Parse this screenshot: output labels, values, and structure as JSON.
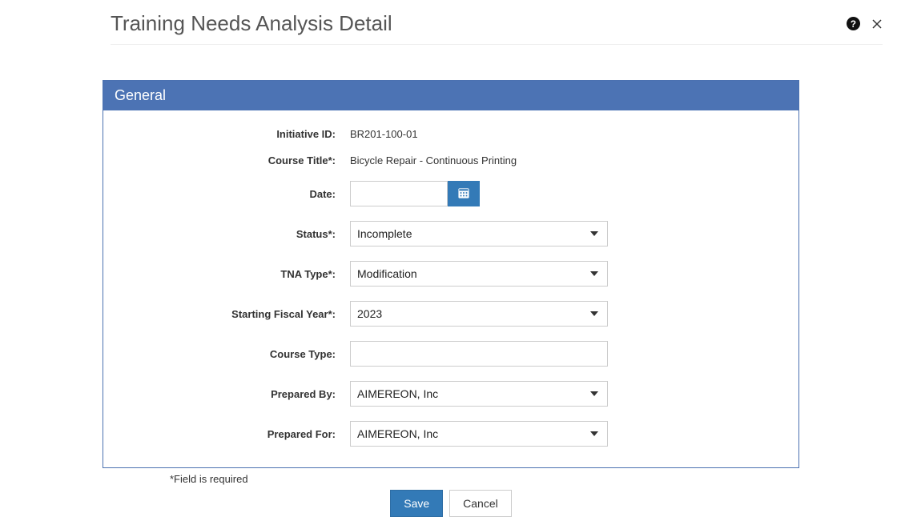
{
  "header": {
    "title": "Training Needs Analysis Detail"
  },
  "panel": {
    "heading": "General"
  },
  "form": {
    "initiative_id_label": "Initiative ID:",
    "initiative_id_value": "BR201-100-01",
    "course_title_label": "Course Title*:",
    "course_title_value": "Bicycle Repair - Continuous Printing",
    "date_label": "Date:",
    "date_value": "",
    "status_label": "Status*:",
    "status_value": "Incomplete",
    "tna_type_label": "TNA Type*:",
    "tna_type_value": "Modification",
    "fiscal_year_label": "Starting Fiscal Year*:",
    "fiscal_year_value": "2023",
    "course_type_label": "Course Type:",
    "course_type_value": "",
    "prepared_by_label": "Prepared By:",
    "prepared_by_value": "AIMEREON, Inc",
    "prepared_for_label": "Prepared For:",
    "prepared_for_value": "AIMEREON, Inc"
  },
  "footer": {
    "required_note": "*Field is required",
    "save_label": "Save",
    "cancel_label": "Cancel"
  }
}
